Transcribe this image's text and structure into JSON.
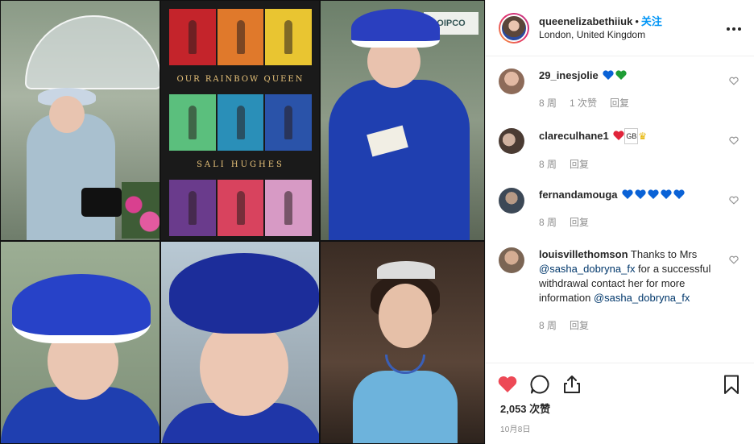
{
  "post": {
    "username": "queenelizabethiiuk",
    "separator": "•",
    "follow_label": "关注",
    "location": "London, United Kingdom",
    "more_icon": "more-options-icon"
  },
  "photo": {
    "book_title": "OUR RAINBOW QUEEN",
    "book_author": "SALI HUGHES",
    "sign_text": "OIPCO",
    "book_colors": [
      "#c4242b",
      "#e0792b",
      "#e9c531",
      "#5bbf7d",
      "#2a8fb8",
      "#2a53a9",
      "#6a3b8c",
      "#d8435e",
      "#d79ac5"
    ]
  },
  "comments": [
    {
      "user": "29_inesjolie",
      "text": "",
      "emojis": [
        "blue-heart",
        "green-heart"
      ],
      "time": "8 周",
      "likes": "1 次赞",
      "reply": "回复",
      "avatar_color": "#b88c74"
    },
    {
      "user": "clareculhane1",
      "text": "",
      "emojis": [
        "red-heart",
        "gb-flag",
        "crown"
      ],
      "time": "8 周",
      "likes": "",
      "reply": "回复",
      "avatar_color": "#6e5a4c"
    },
    {
      "user": "fernandamouga",
      "text": "",
      "emojis": [
        "blue-heart",
        "blue-heart",
        "blue-heart",
        "blue-heart",
        "blue-heart"
      ],
      "time": "8 周",
      "likes": "",
      "reply": "回复",
      "avatar_color": "#4b5a6b"
    },
    {
      "user": "louisvillethomson",
      "text": "Thanks to Mrs",
      "mention1": "@sasha_dobryna_fx",
      "text2": " for a successful withdrawal contact her for more information",
      "mention2": "@sasha_dobryna_fx",
      "time": "8 周",
      "likes": "",
      "reply": "回复",
      "avatar_color": "#8c7460"
    }
  ],
  "emoji_text": {
    "gb": "GB",
    "crown": "♛"
  },
  "actions": {
    "like_icon": "heart-filled-icon",
    "comment_icon": "comment-icon",
    "share_icon": "share-icon",
    "save_icon": "bookmark-icon",
    "likes_count": "2,053 次赞",
    "date": "10月8日"
  },
  "colors": {
    "link_blue": "#0095f6",
    "like_red": "#ed4956",
    "blue_heart": "#0a62d6",
    "green_heart": "#1f9d35"
  }
}
